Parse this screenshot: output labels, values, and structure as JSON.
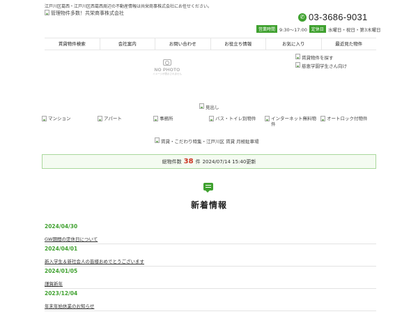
{
  "header": {
    "tagline": "江戸川区葛西・江戸川区西葛西周辺の不動産情報は共栄商事株式会社にお任せください。",
    "logo_alt": "管理物件多数！共栄商事株式会社",
    "phone": "03-3686-9031",
    "phone_icon": "phone-icon",
    "hours_label": "営業時間",
    "hours_value": "9:30～17:00",
    "holiday_label": "定休日",
    "holiday_value": "水曜日・祝日・第3木曜日"
  },
  "nav": {
    "items": [
      {
        "label": "賃貸物件検索"
      },
      {
        "label": "会社案内"
      },
      {
        "label": "お問い合わせ"
      },
      {
        "label": "お役立ち情報"
      },
      {
        "label": "お気に入り"
      },
      {
        "label": "最近見た物件"
      }
    ]
  },
  "banner": {
    "nophoto_text": "NO PHOTO",
    "nophoto_sub": "イメージが表示されません",
    "side_links": [
      "賃貸物件を探す",
      "慈恵学園学生さん向け"
    ],
    "heading_alt": "見出し"
  },
  "categories": [
    {
      "label": "マンション"
    },
    {
      "label": "アパート"
    },
    {
      "label": "事務所"
    },
    {
      "label": "バス・トイレ別物件"
    },
    {
      "label": "インターネット無料物件"
    },
    {
      "label": "オートロック付物件"
    }
  ],
  "feature_banner": "賃貸・こだわり特集・江戸川区 賃貸 月極駐車場",
  "count": {
    "prefix": "総物件数",
    "number": "38",
    "suffix": "件",
    "updated": "2024/07/14 15:40更新"
  },
  "news": {
    "title": "新着情報",
    "items": [
      {
        "date": "2024/04/30",
        "title": "GW期間の定休日について"
      },
      {
        "date": "2024/04/01",
        "title": "新入学生＆新社会人の皆様おめでとうございます"
      },
      {
        "date": "2024/01/05",
        "title": "謹賀新年"
      },
      {
        "date": "2023/12/04",
        "title": "年末年始休業のお知らせ"
      }
    ]
  },
  "colors": {
    "accent": "#3fa12f",
    "count_number": "#cc3322"
  }
}
